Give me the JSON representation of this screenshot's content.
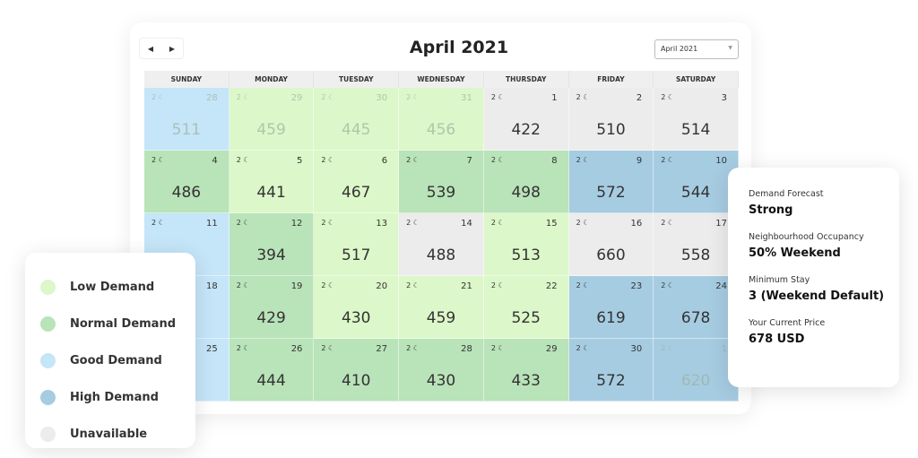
{
  "colors": {
    "low": "#dcf7c9",
    "normal": "#b9e3b9",
    "good": "#c5e5f8",
    "high": "#a6cce2",
    "unavailable": "#ececec"
  },
  "header": {
    "title": "April 2021",
    "prev_icon": "caret-left-icon",
    "next_icon": "caret-right-icon",
    "month_select": "April 2021"
  },
  "weekdays": [
    "SUNDAY",
    "MONDAY",
    "TUESDAY",
    "WEDNESDAY",
    "THURSDAY",
    "FRIDAY",
    "SATURDAY"
  ],
  "min_stay_icon": "moon-icon",
  "days": [
    {
      "day": "28",
      "min": "2",
      "price": "511",
      "demand": "good",
      "faded": true
    },
    {
      "day": "29",
      "min": "2",
      "price": "459",
      "demand": "low",
      "faded": true
    },
    {
      "day": "30",
      "min": "2",
      "price": "445",
      "demand": "low",
      "faded": true
    },
    {
      "day": "31",
      "min": "2",
      "price": "456",
      "demand": "low",
      "faded": true
    },
    {
      "day": "1",
      "min": "2",
      "price": "422",
      "demand": "unavailable"
    },
    {
      "day": "2",
      "min": "2",
      "price": "510",
      "demand": "unavailable"
    },
    {
      "day": "3",
      "min": "2",
      "price": "514",
      "demand": "unavailable"
    },
    {
      "day": "4",
      "min": "2",
      "price": "486",
      "demand": "normal"
    },
    {
      "day": "5",
      "min": "2",
      "price": "441",
      "demand": "low"
    },
    {
      "day": "6",
      "min": "2",
      "price": "467",
      "demand": "low"
    },
    {
      "day": "7",
      "min": "2",
      "price": "539",
      "demand": "normal"
    },
    {
      "day": "8",
      "min": "2",
      "price": "498",
      "demand": "normal"
    },
    {
      "day": "9",
      "min": "2",
      "price": "572",
      "demand": "high"
    },
    {
      "day": "10",
      "min": "2",
      "price": "544",
      "demand": "high"
    },
    {
      "day": "11",
      "min": "2",
      "price": "",
      "demand": "good"
    },
    {
      "day": "12",
      "min": "2",
      "price": "394",
      "demand": "normal"
    },
    {
      "day": "13",
      "min": "2",
      "price": "517",
      "demand": "low"
    },
    {
      "day": "14",
      "min": "2",
      "price": "488",
      "demand": "unavailable"
    },
    {
      "day": "15",
      "min": "2",
      "price": "513",
      "demand": "low"
    },
    {
      "day": "16",
      "min": "2",
      "price": "660",
      "demand": "unavailable"
    },
    {
      "day": "17",
      "min": "2",
      "price": "558",
      "demand": "unavailable"
    },
    {
      "day": "18",
      "min": "",
      "price": "",
      "demand": "good"
    },
    {
      "day": "19",
      "min": "2",
      "price": "429",
      "demand": "normal"
    },
    {
      "day": "20",
      "min": "2",
      "price": "430",
      "demand": "low"
    },
    {
      "day": "21",
      "min": "2",
      "price": "459",
      "demand": "low"
    },
    {
      "day": "22",
      "min": "2",
      "price": "525",
      "demand": "low"
    },
    {
      "day": "23",
      "min": "2",
      "price": "619",
      "demand": "high"
    },
    {
      "day": "24",
      "min": "2",
      "price": "678",
      "demand": "high"
    },
    {
      "day": "25",
      "min": "",
      "price": "",
      "demand": "good"
    },
    {
      "day": "26",
      "min": "2",
      "price": "444",
      "demand": "normal"
    },
    {
      "day": "27",
      "min": "2",
      "price": "410",
      "demand": "normal"
    },
    {
      "day": "28",
      "min": "2",
      "price": "430",
      "demand": "normal"
    },
    {
      "day": "29",
      "min": "2",
      "price": "433",
      "demand": "normal"
    },
    {
      "day": "30",
      "min": "2",
      "price": "572",
      "demand": "high"
    },
    {
      "day": "1",
      "min": "2",
      "price": "620",
      "demand": "high",
      "faded": true
    }
  ],
  "legend": [
    {
      "label": "Low Demand",
      "key": "low"
    },
    {
      "label": "Normal Demand",
      "key": "normal"
    },
    {
      "label": "Good Demand",
      "key": "good"
    },
    {
      "label": "High Demand",
      "key": "high"
    },
    {
      "label": "Unavailable",
      "key": "unavailable"
    }
  ],
  "info": [
    {
      "label": "Demand Forecast",
      "value": "Strong"
    },
    {
      "label": "Neighbourhood Occupancy",
      "value": "50% Weekend"
    },
    {
      "label": "Minimum Stay",
      "value": "3 (Weekend Default)"
    },
    {
      "label": "Your Current Price",
      "value": "678 USD"
    }
  ]
}
